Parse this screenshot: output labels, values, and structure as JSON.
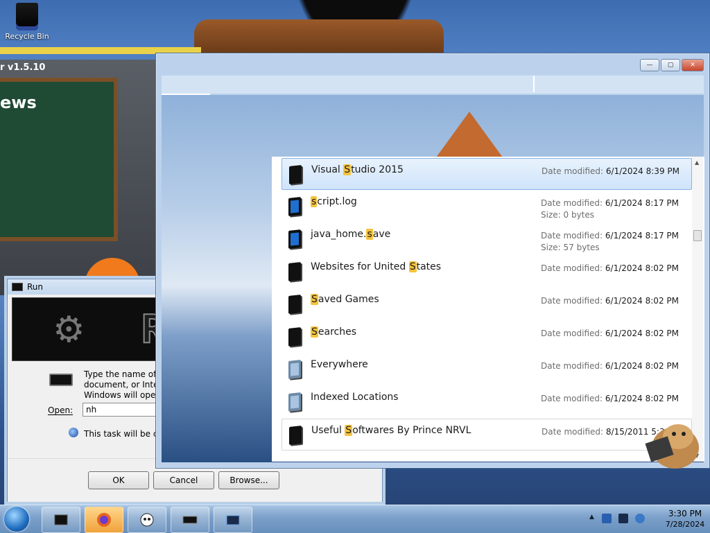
{
  "desktop": {
    "recycle_bin_label": "Recycle Bin"
  },
  "background_app": {
    "title": "r v1.5.10",
    "heading": "ews"
  },
  "run_dialog": {
    "title": "Run",
    "banner_text": "RUN",
    "prompt": "Type the name of a program, folder, document, or Internet resource, and Windows will open it for you.",
    "open_label": "Open:",
    "open_value": "nh",
    "admin_note": "This task will be created with administrative privileges.",
    "ok_label": "OK",
    "cancel_label": "Cancel",
    "browse_label": "Browse..."
  },
  "search_window": {
    "caption": {
      "minimize": "—",
      "maximize": "▢",
      "close": "✕"
    },
    "results": [
      {
        "pre": "Visual ",
        "hl": "S",
        "post": "tudio 2015",
        "date_label": "Date modified:",
        "date": "6/1/2024 8:39 PM",
        "size_label": "",
        "size": "",
        "icon": "folder-icon",
        "state": "selected"
      },
      {
        "pre": "",
        "hl": "s",
        "post": "cript.log",
        "date_label": "Date modified:",
        "date": "6/1/2024 8:17 PM",
        "size_label": "Size:",
        "size": "0 bytes",
        "icon": "document-icon",
        "state": ""
      },
      {
        "pre": "java_home.",
        "hl": "s",
        "post": "ave",
        "date_label": "Date modified:",
        "date": "6/1/2024 8:17 PM",
        "size_label": "Size:",
        "size": "57 bytes",
        "icon": "document-icon",
        "state": ""
      },
      {
        "pre": "Websites for United ",
        "hl": "S",
        "post": "tates",
        "date_label": "Date modified:",
        "date": "6/1/2024 8:02 PM",
        "size_label": "",
        "size": "",
        "icon": "folder-icon",
        "state": ""
      },
      {
        "pre": "",
        "hl": "S",
        "post": "aved Games",
        "date_label": "Date modified:",
        "date": "6/1/2024 8:02 PM",
        "size_label": "",
        "size": "",
        "icon": "folder-icon",
        "state": ""
      },
      {
        "pre": "",
        "hl": "S",
        "post": "earches",
        "date_label": "Date modified:",
        "date": "6/1/2024 8:02 PM",
        "size_label": "",
        "size": "",
        "icon": "folder-icon",
        "state": ""
      },
      {
        "pre": "Everywhere",
        "hl": "",
        "post": "",
        "date_label": "Date modified:",
        "date": "6/1/2024 8:02 PM",
        "size_label": "",
        "size": "",
        "icon": "library-icon",
        "state": ""
      },
      {
        "pre": "Indexed Locations",
        "hl": "",
        "post": "",
        "date_label": "Date modified:",
        "date": "6/1/2024 8:02 PM",
        "size_label": "",
        "size": "",
        "icon": "library-icon",
        "state": ""
      },
      {
        "pre": "Useful ",
        "hl": "S",
        "post": "oftwares By Prince NRVL",
        "date_label": "Date modified:",
        "date": "8/15/2011 5:36 PM",
        "size_label": "",
        "size": "",
        "icon": "folder-icon",
        "state": "hover"
      }
    ]
  },
  "taskbar": {
    "items": [
      {
        "name": "taskbar-app-terminal",
        "icon": "terminal-icon",
        "active": false
      },
      {
        "name": "taskbar-app-firefox",
        "icon": "firefox-icon",
        "active": true
      },
      {
        "name": "taskbar-app-mascot",
        "icon": "mascot-icon",
        "active": false
      },
      {
        "name": "taskbar-app-run",
        "icon": "run-icon",
        "active": false
      },
      {
        "name": "taskbar-app-window",
        "icon": "window-icon",
        "active": false
      }
    ],
    "clock_time": "3:30 PM",
    "clock_date": "7/28/2024"
  },
  "colors": {
    "highlight": "#f7c33c",
    "selection": "#cfe4fb",
    "taskbar": "#7a9fc8"
  }
}
